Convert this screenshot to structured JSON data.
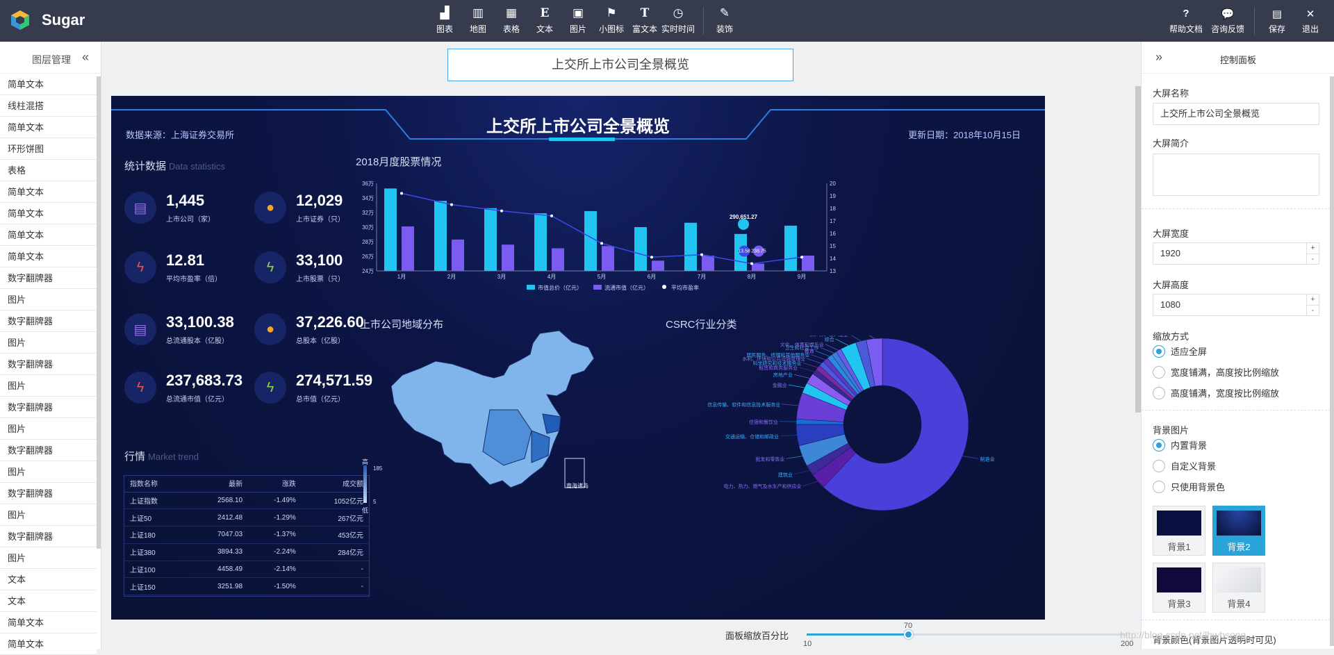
{
  "app": {
    "name": "Sugar"
  },
  "toolbar": {
    "items": [
      {
        "label": "图表",
        "icon": "bar-chart-icon"
      },
      {
        "label": "地图",
        "icon": "map-icon"
      },
      {
        "label": "表格",
        "icon": "table-icon"
      },
      {
        "label": "文本",
        "icon": "text-icon"
      },
      {
        "label": "图片",
        "icon": "image-icon"
      },
      {
        "label": "小图标",
        "icon": "flag-icon"
      },
      {
        "label": "富文本",
        "icon": "rich-text-icon"
      },
      {
        "label": "实时时间",
        "icon": "clock-icon"
      },
      {
        "label": "装饰",
        "icon": "magic-wand-icon"
      }
    ],
    "right": [
      {
        "label": "帮助文档",
        "icon": "question-icon"
      },
      {
        "label": "咨询反馈",
        "icon": "chat-bubble-icon"
      },
      {
        "label": "保存",
        "icon": "save-icon"
      },
      {
        "label": "退出",
        "icon": "close-icon"
      }
    ]
  },
  "layers": {
    "title": "图层管理",
    "items": [
      "简单文本",
      "线柱混搭",
      "简单文本",
      "环形饼图",
      "表格",
      "简单文本",
      "简单文本",
      "简单文本",
      "简单文本",
      "数字翻牌器",
      "图片",
      "数字翻牌器",
      "图片",
      "数字翻牌器",
      "图片",
      "数字翻牌器",
      "图片",
      "数字翻牌器",
      "图片",
      "数字翻牌器",
      "图片",
      "数字翻牌器",
      "图片",
      "文本",
      "文本",
      "简单文本",
      "简单文本"
    ]
  },
  "canvas": {
    "title_value": "上交所上市公司全景概览",
    "dashboard": {
      "title": "上交所上市公司全景概览",
      "source": "数据来源：上海证券交易所",
      "date": "更新日期：2018年10月15日",
      "stats_title": "统计数据",
      "stats_title_en": "Data statistics",
      "stats": [
        {
          "value": "1,445",
          "label": "上市公司（家）"
        },
        {
          "value": "12,029",
          "label": "上市证券（只）"
        },
        {
          "value": "12.81",
          "label": "平均市盈率（倍）"
        },
        {
          "value": "33,100",
          "label": "上市股票（只）"
        },
        {
          "value": "33,100.38",
          "label": "总流通股本（亿股）"
        },
        {
          "value": "37,226.60",
          "label": "总股本（亿股）"
        },
        {
          "value": "237,683.73",
          "label": "总流通市值（亿元）"
        },
        {
          "value": "274,571.59",
          "label": "总市值（亿元）"
        }
      ],
      "market_title": "行情",
      "market_title_en": "Market trend",
      "market_headers": [
        "指数名称",
        "最新",
        "涨跌",
        "成交额"
      ],
      "market_rows": [
        [
          "上证指数",
          "2568.10",
          "-1.49%",
          "1052亿元"
        ],
        [
          "上证50",
          "2412.48",
          "-1.29%",
          "267亿元"
        ],
        [
          "上证180",
          "7047.03",
          "-1.37%",
          "453亿元"
        ],
        [
          "上证380",
          "3894.33",
          "-2.24%",
          "284亿元"
        ],
        [
          "上证100",
          "4458.49",
          "-2.14%",
          "-"
        ],
        [
          "上证150",
          "3251.98",
          "-1.50%",
          "-"
        ]
      ],
      "bar_title": "2018月度股票情况",
      "map_title": "上市公司地域分布",
      "map_legend_high": "高",
      "map_legend_low": "低",
      "map_legend_max": "185",
      "map_legend_min": "5",
      "map_inset": "南海诸岛",
      "pie_title": "CSRC行业分类"
    }
  },
  "chart_data": [
    {
      "type": "bar",
      "title": "2018月度股票情况",
      "categories": [
        "1月",
        "2月",
        "3月",
        "4月",
        "5月",
        "6月",
        "7月",
        "8月",
        "9月"
      ],
      "y_left_ticks": [
        "24万",
        "26万",
        "28万",
        "30万",
        "32万",
        "34万",
        "36万"
      ],
      "y_left_range": [
        240000,
        360000
      ],
      "y_right_ticks": [
        "13",
        "14",
        "15",
        "16",
        "17",
        "18",
        "19",
        "20"
      ],
      "y_right_range": [
        13,
        20
      ],
      "series": [
        {
          "name": "市值总价（亿元）",
          "kind": "bar",
          "color": "#22c4f2",
          "values": [
            353000,
            336000,
            326000,
            319000,
            322000,
            300000,
            306000,
            290651,
            302000
          ]
        },
        {
          "name": "流通市值（亿元）",
          "kind": "bar",
          "color": "#7b5cf0",
          "values": [
            301000,
            283000,
            276000,
            271000,
            274000,
            254000,
            261000,
            250000,
            261000
          ]
        },
        {
          "name": "平均市盈率",
          "kind": "line",
          "color": "#3a48e8",
          "values": [
            19.2,
            18.3,
            17.8,
            17.4,
            15.2,
            14.1,
            14.3,
            13.58,
            14.1
          ]
        }
      ],
      "annotations": [
        "290,651.27",
        "13.58",
        "238.75"
      ]
    },
    {
      "type": "pie",
      "title": "CSRC行业分类",
      "labels": [
        "制造业",
        "电力、热力、燃气及水生产和供应业",
        "建筑业",
        "批发和零售业",
        "交通运输、仓储和邮政业",
        "住宿和餐饮业",
        "信息传输、软件和信息技术服务业",
        "金融业",
        "房地产业",
        "租赁和商务服务业",
        "科学研究和技术服务业",
        "水利、环境和公共设施管理业",
        "居民服务、修理和其他服务业",
        "教育",
        "卫生和社会工作",
        "文化、体育和娱乐业",
        "综合",
        "农、林、牧、渔业",
        "采矿业"
      ],
      "values": [
        62,
        3,
        2,
        4,
        4,
        1,
        5,
        2,
        2,
        1,
        1,
        1,
        1,
        1,
        1,
        1,
        3,
        2,
        3
      ]
    }
  ],
  "control": {
    "title": "控制面板",
    "name_label": "大屏名称",
    "name_value": "上交所上市公司全景概览",
    "intro_label": "大屏简介",
    "width_label": "大屏宽度",
    "width_value": "1920",
    "height_label": "大屏高度",
    "height_value": "1080",
    "scale_label": "缩放方式",
    "scale_options": [
      "适应全屏",
      "宽度铺满，高度按比例缩放",
      "高度铺满，宽度按比例缩放"
    ],
    "bg_label": "背景图片",
    "bg_options": [
      "内置背景",
      "自定义背景",
      "只使用背景色"
    ],
    "bg_presets": [
      "背景1",
      "背景2",
      "背景3",
      "背景4"
    ],
    "bgcolor_label": "背景颜色(背景图片透明时可见)"
  },
  "zoom": {
    "label": "面板缩放百分比",
    "value": 70,
    "min": 10,
    "max": 200
  },
  "watermark": "http://blog.csdn.net/lhwhsong"
}
